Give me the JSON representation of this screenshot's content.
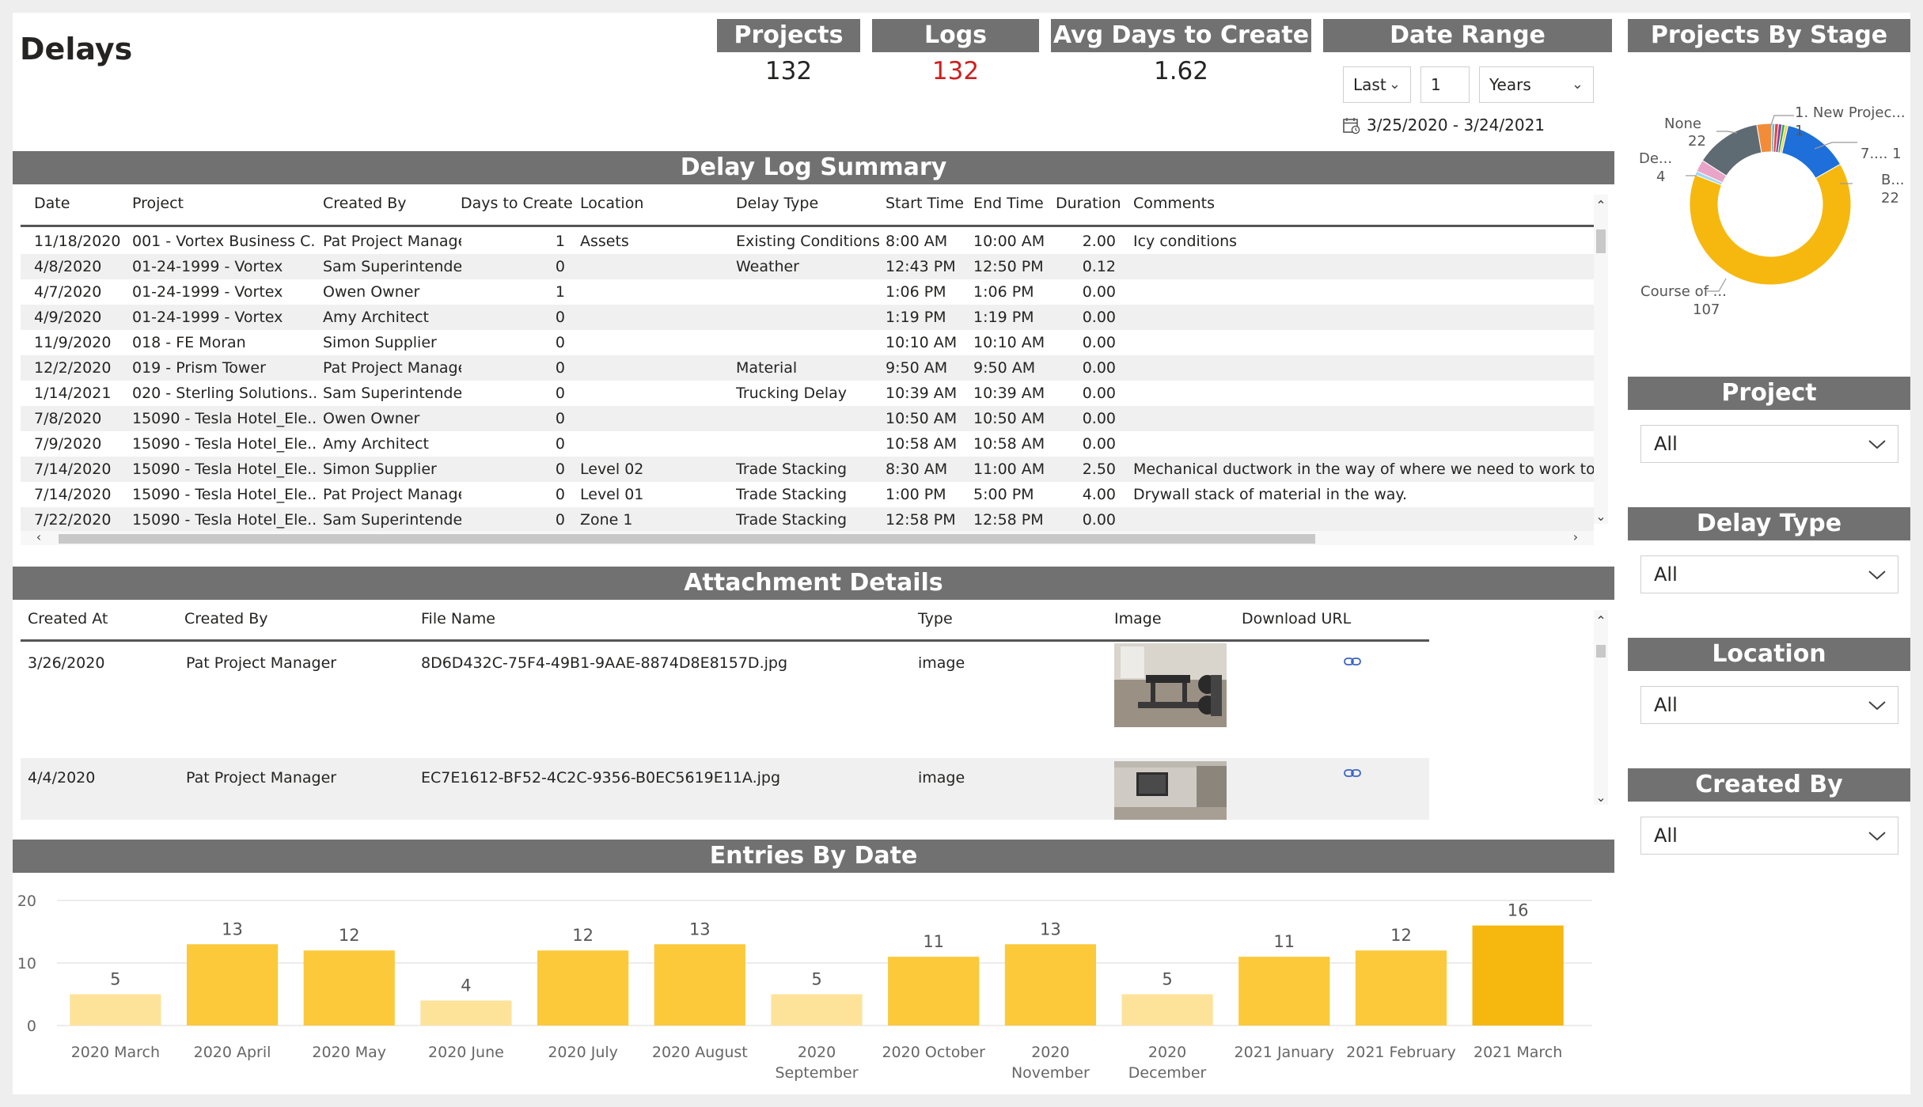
{
  "page": {
    "title": "Delays"
  },
  "kpis": {
    "projects": {
      "label": "Projects",
      "value": "132"
    },
    "logs": {
      "label": "Logs",
      "value": "132",
      "color": "#d11d1d"
    },
    "avg_days": {
      "label": "Avg Days to Create",
      "value": "1.62"
    }
  },
  "date_range": {
    "label": "Date Range",
    "relative": "Last",
    "count": "1",
    "unit": "Years",
    "range_text": "3/25/2020 - 3/24/2021"
  },
  "projects_by_stage": {
    "title": "Projects By Stage",
    "labels": [
      {
        "name": "1. New Projec...",
        "value": "1"
      },
      {
        "name": "7....",
        "value": "1"
      },
      {
        "name": "B...",
        "value": "22"
      },
      {
        "name": "Course of ...",
        "value": "107"
      },
      {
        "name": "De...",
        "value": "4"
      },
      {
        "name": "None",
        "value": "22"
      }
    ],
    "colors": {
      "new": "#6fb6d0",
      "stage2": "#e8423a",
      "stage3": "#8a3fa0",
      "stage4": "#2fa84f",
      "seven": "#f4d03f",
      "b": "#1e6fd9",
      "course": "#f6b80e",
      "de": "#e9a5c7",
      "none": "#5f6b73",
      "orange": "#f28c38"
    }
  },
  "delay_log": {
    "title": "Delay Log Summary",
    "columns": {
      "date": "Date",
      "project": "Project",
      "created_by": "Created By",
      "days": "Days to Create",
      "location": "Location",
      "delay_type": "Delay Type",
      "start": "Start Time",
      "end": "End Time",
      "duration": "Duration",
      "comments": "Comments"
    },
    "rows": [
      {
        "date": "11/18/2020",
        "project": "001 - Vortex Business C...",
        "created_by": "Pat Project Manager",
        "days": "1",
        "location": "Assets",
        "delay_type": "Existing Conditions",
        "start": "8:00 AM",
        "end": "10:00 AM",
        "duration": "2.00",
        "comments": "Icy conditions"
      },
      {
        "date": "4/8/2020",
        "project": "01-24-1999 - Vortex",
        "created_by": "Sam Superintendent",
        "days": "0",
        "location": "",
        "delay_type": "Weather",
        "start": "12:43 PM",
        "end": "12:50 PM",
        "duration": "0.12",
        "comments": ""
      },
      {
        "date": "4/7/2020",
        "project": "01-24-1999 - Vortex",
        "created_by": "Owen Owner",
        "days": "1",
        "location": "",
        "delay_type": "",
        "start": "1:06 PM",
        "end": "1:06 PM",
        "duration": "0.00",
        "comments": ""
      },
      {
        "date": "4/9/2020",
        "project": "01-24-1999 - Vortex",
        "created_by": "Amy Architect",
        "days": "0",
        "location": "",
        "delay_type": "",
        "start": "1:19 PM",
        "end": "1:19 PM",
        "duration": "0.00",
        "comments": ""
      },
      {
        "date": "11/9/2020",
        "project": "018 - FE Moran",
        "created_by": "Simon Supplier",
        "days": "0",
        "location": "",
        "delay_type": "",
        "start": "10:10 AM",
        "end": "10:10 AM",
        "duration": "0.00",
        "comments": ""
      },
      {
        "date": "12/2/2020",
        "project": "019 - Prism Tower",
        "created_by": "Pat Project Manager",
        "days": "0",
        "location": "",
        "delay_type": "Material",
        "start": "9:50 AM",
        "end": "9:50 AM",
        "duration": "0.00",
        "comments": ""
      },
      {
        "date": "1/14/2021",
        "project": "020 - Sterling Solutions...",
        "created_by": "Sam Superintendent",
        "days": "0",
        "location": "",
        "delay_type": "Trucking Delay",
        "start": "10:39 AM",
        "end": "10:39 AM",
        "duration": "0.00",
        "comments": ""
      },
      {
        "date": "7/8/2020",
        "project": "15090 - Tesla Hotel_Ele...",
        "created_by": "Owen Owner",
        "days": "0",
        "location": "",
        "delay_type": "",
        "start": "10:50 AM",
        "end": "10:50 AM",
        "duration": "0.00",
        "comments": ""
      },
      {
        "date": "7/9/2020",
        "project": "15090 - Tesla Hotel_Ele...",
        "created_by": "Amy Architect",
        "days": "0",
        "location": "",
        "delay_type": "",
        "start": "10:58 AM",
        "end": "10:58 AM",
        "duration": "0.00",
        "comments": ""
      },
      {
        "date": "7/14/2020",
        "project": "15090 - Tesla Hotel_Ele...",
        "created_by": "Simon Supplier",
        "days": "0",
        "location": "Level 02",
        "delay_type": "Trade Stacking",
        "start": "8:30 AM",
        "end": "11:00 AM",
        "duration": "2.50",
        "comments": "Mechanical ductwork in the way of where we need to work to insta"
      },
      {
        "date": "7/14/2020",
        "project": "15090 - Tesla Hotel_Ele...",
        "created_by": "Pat Project Manager",
        "days": "0",
        "location": "Level 01",
        "delay_type": "Trade Stacking",
        "start": "1:00 PM",
        "end": "5:00 PM",
        "duration": "4.00",
        "comments": "Drywall stack of material in the way."
      },
      {
        "date": "7/22/2020",
        "project": "15090 - Tesla Hotel_Ele...",
        "created_by": "Sam Superintendent",
        "days": "0",
        "location": "Zone 1",
        "delay_type": "Trade Stacking",
        "start": "12:58 PM",
        "end": "12:58 PM",
        "duration": "0.00",
        "comments": ""
      }
    ]
  },
  "attachments": {
    "title": "Attachment Details",
    "columns": {
      "created_at": "Created At",
      "created_by": "Created By",
      "file_name": "File Name",
      "type": "Type",
      "image": "Image",
      "url": "Download URL"
    },
    "rows": [
      {
        "created_at": "3/26/2020",
        "created_by": "Pat Project Manager",
        "file_name": "8D6D432C-75F4-49B1-9AAE-8874D8E8157D.jpg",
        "type": "image",
        "image": "gym-room-photo",
        "url_icon": "link-icon"
      },
      {
        "created_at": "4/4/2020",
        "created_by": "Pat Project Manager",
        "file_name": "EC7E1612-BF52-4C2C-9356-B0EC5619E11A.jpg",
        "type": "image",
        "image": "room-window-photo",
        "url_icon": "link-icon"
      }
    ]
  },
  "slicers": {
    "project": {
      "label": "Project",
      "value": "All"
    },
    "delay_type": {
      "label": "Delay Type",
      "value": "All"
    },
    "location": {
      "label": "Location",
      "value": "All"
    },
    "created_by": {
      "label": "Created By",
      "value": "All"
    }
  },
  "chart_data": {
    "type": "bar",
    "title": "Entries By Date",
    "categories": [
      "2020 March",
      "2020 April",
      "2020 May",
      "2020 June",
      "2020 July",
      "2020 August",
      "2020 September",
      "2020 October",
      "2020 November",
      "2020 December",
      "2021 January",
      "2021 February",
      "2021 March"
    ],
    "values": [
      5,
      13,
      12,
      4,
      12,
      13,
      5,
      11,
      13,
      5,
      11,
      12,
      16
    ],
    "ylim": [
      0,
      20
    ],
    "yticks": [
      0,
      10,
      20
    ],
    "grid": true,
    "color_scale": {
      "low": "#fde39a",
      "mid": "#fbc93a",
      "high": "#f6b80e"
    }
  }
}
